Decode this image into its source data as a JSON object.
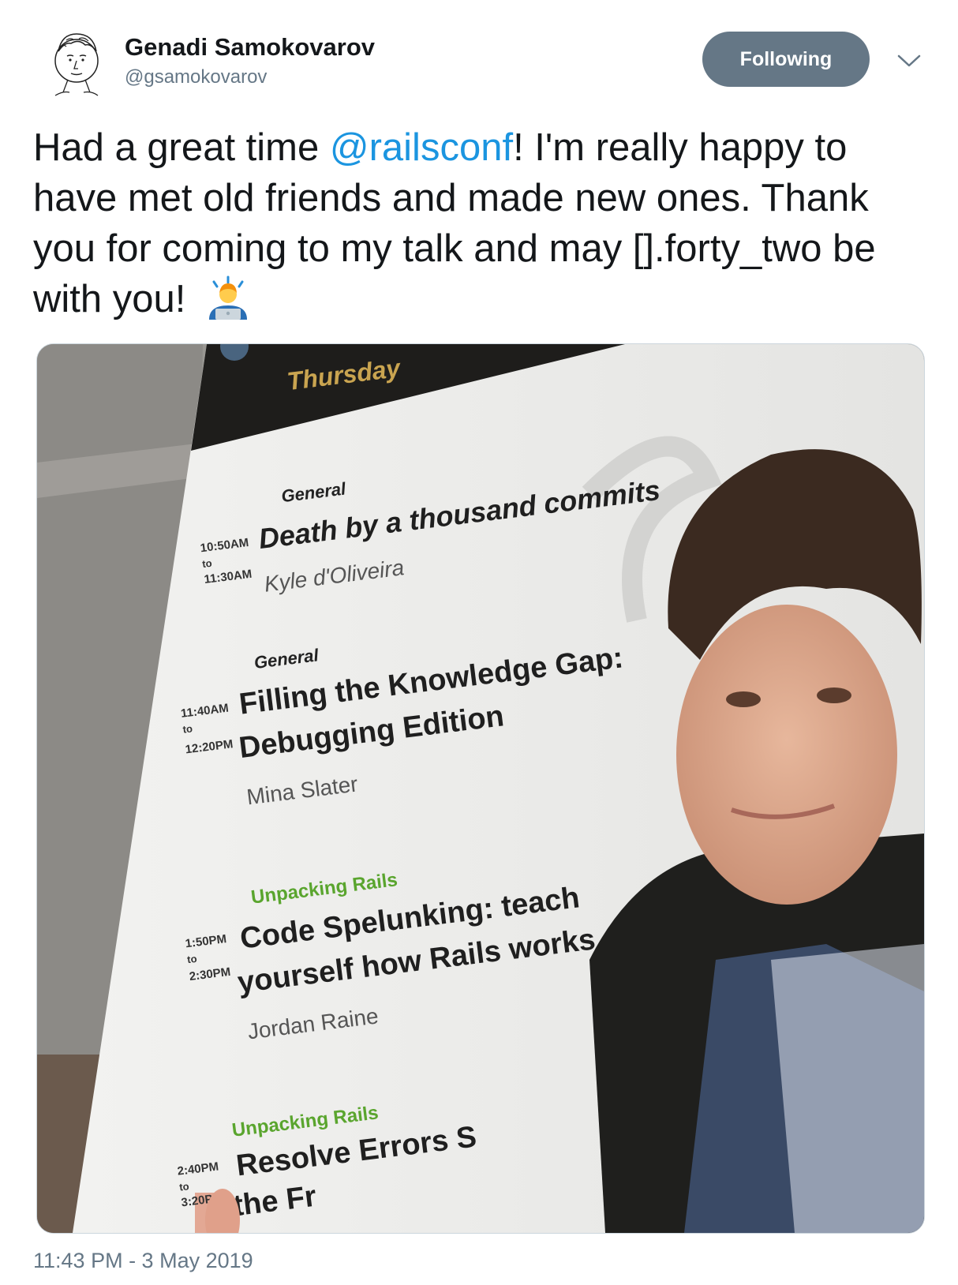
{
  "author": {
    "name": "Genadi Samokovarov",
    "handle": "@gsamokovarov"
  },
  "follow_button": {
    "label": "Following"
  },
  "tweet": {
    "text_before_mention": "Had a great time ",
    "mention": "@railsconf",
    "text_after_mention": "! I'm really happy to have met old friends and made new ones. Thank you for coming to my talk and may [].forty_two be with you! "
  },
  "photo_sign": {
    "day": "Thursday",
    "sessions": [
      {
        "track": "General",
        "start": "10:50AM",
        "to": "to",
        "end": "11:30AM",
        "title_line1": "Death by a thousand commits",
        "title_line2": "",
        "speaker": "Kyle d'Oliveira"
      },
      {
        "track": "General",
        "start": "11:40AM",
        "to": "to",
        "end": "12:20PM",
        "title_line1": "Filling the Knowledge Gap:",
        "title_line2": "Debugging Edition",
        "speaker": "Mina Slater"
      },
      {
        "track": "Unpacking Rails",
        "start": "1:50PM",
        "to": "to",
        "end": "2:30PM",
        "title_line1": "Code Spelunking: teach",
        "title_line2": "yourself how Rails works",
        "speaker": "Jordan Raine"
      },
      {
        "track": "Unpacking Rails",
        "start": "2:40PM",
        "to": "to",
        "end": "3:20PM",
        "title_line1": "Resolve Errors S",
        "title_line2": "the Fr",
        "speaker": ""
      }
    ]
  },
  "timestamp": "11:43 PM - 3 May 2019",
  "icons": {
    "avatar": "sketch-portrait-avatar",
    "chevron": "chevron-down-icon",
    "emoji": "man-technologist-emoji"
  },
  "colors": {
    "mention": "#1b95e0",
    "button_bg": "#657786",
    "track_green": "#5aa52e"
  }
}
